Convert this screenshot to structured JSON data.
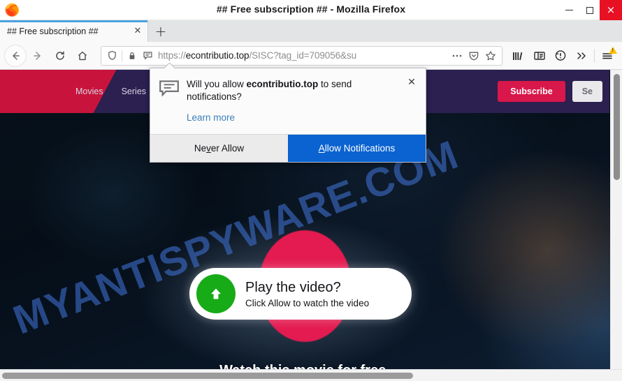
{
  "window": {
    "title": "## Free subscription ## - Mozilla Firefox",
    "controls": {
      "minimize": "minimize-button",
      "maximize": "maximize-button",
      "close": "×"
    }
  },
  "tabbar": {
    "tab_title": "## Free subscription ##",
    "tab_close": "✕",
    "new_tab": "+"
  },
  "toolbar": {
    "url_protocol": "https://",
    "url_domain": "econtributio.top",
    "url_path": "/SISC?tag_id=709056&su",
    "url_full": "https://econtributio.top/SISC?tag_id=709056&su"
  },
  "doorhanger": {
    "message_prefix": "Will you allow ",
    "message_domain": "econtributio.top",
    "message_suffix": " to send notifications?",
    "learn_more": "Learn more",
    "close": "✕",
    "never_allow": "Never Allow",
    "never_allow_key": "v",
    "allow": "Allow Notifications",
    "allow_key": "A"
  },
  "site": {
    "nav": [
      {
        "label": "Movies"
      },
      {
        "label": "Series"
      }
    ],
    "subscribe": "Subscribe",
    "search": "Se",
    "watermark": "MYANTISPYWARE.COM",
    "play_title": "Play the video?",
    "play_subtitle": "Click Allow to watch the video",
    "free_line": "Watch this movie for free."
  },
  "colors": {
    "header_purple": "#2b2050",
    "header_red": "#c8143c",
    "subscribe_red": "#d8174a",
    "pink_circle": "#e31b50",
    "play_green": "#17ab17",
    "primary_blue": "#0a63d1",
    "link_blue": "#3a7fba",
    "close_red": "#e81123",
    "tab_accent": "#4aa3df",
    "watermark_blue": "rgba(62,110,205,0.60)"
  }
}
